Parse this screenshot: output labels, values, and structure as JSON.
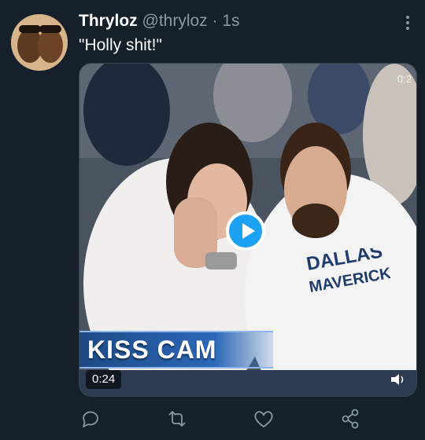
{
  "tweet": {
    "display_name": "Thryloz",
    "handle": "@thryloz",
    "separator": "·",
    "time": "1s",
    "text": "\"Holly shit!\""
  },
  "media": {
    "top_timestamp": "0:2",
    "banner_text": "KISS CAM",
    "duration": "0:24",
    "shirt_text_line1": "DALLAS",
    "shirt_text_line2": "MAVERICK"
  },
  "actions": [
    "reply-icon",
    "retweet-icon",
    "like-icon",
    "share-icon"
  ],
  "colors": {
    "background": "#15202b",
    "secondary_text": "#8899a6",
    "accent": "#1da1f2"
  }
}
